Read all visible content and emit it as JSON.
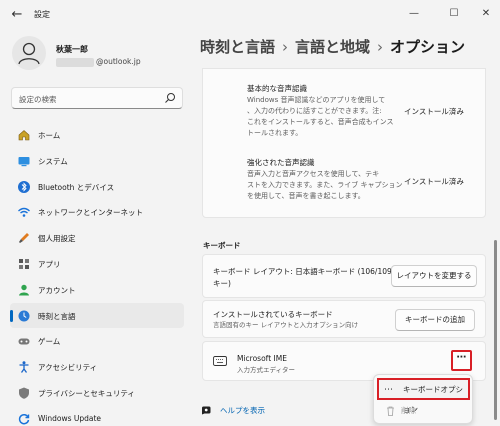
{
  "window": {
    "title": "設定",
    "back_glyph": "←",
    "minimize_glyph": "—",
    "maximize_glyph": "☐",
    "close_glyph": "✕"
  },
  "profile": {
    "name": "秋葉一郎",
    "email_suffix": "@outlook.jp"
  },
  "search": {
    "placeholder": "設定の検索"
  },
  "nav": {
    "items": [
      {
        "label": "ホーム",
        "icon": "home-icon"
      },
      {
        "label": "システム",
        "icon": "system-icon"
      },
      {
        "label": "Bluetooth とデバイス",
        "icon": "bluetooth-icon"
      },
      {
        "label": "ネットワークとインターネット",
        "icon": "network-icon"
      },
      {
        "label": "個人用設定",
        "icon": "personalization-icon"
      },
      {
        "label": "アプリ",
        "icon": "apps-icon"
      },
      {
        "label": "アカウント",
        "icon": "accounts-icon"
      },
      {
        "label": "時刻と言語",
        "icon": "time-language-icon",
        "active": true
      },
      {
        "label": "ゲーム",
        "icon": "gaming-icon"
      },
      {
        "label": "アクセシビリティ",
        "icon": "accessibility-icon"
      },
      {
        "label": "プライバシーとセキュリティ",
        "icon": "privacy-icon"
      },
      {
        "label": "Windows Update",
        "icon": "windows-update-icon"
      }
    ]
  },
  "breadcrumb": {
    "level1": "時刻と言語",
    "level2": "言語と地域",
    "current": "オプション",
    "separator": "›"
  },
  "speech": {
    "basic_title": "基本的な音声認識",
    "basic_desc_1": "Windows 音声認識などのアプリを使用して",
    "basic_desc_2": "、入力の代わりに話すことができます。注:",
    "basic_desc_3": "これをインストールすると、音声合成もインス",
    "basic_desc_4": "トールされます。",
    "basic_status": "インストール済み",
    "enhanced_title": "強化された音声認識",
    "enhanced_desc_1": "音声入力と音声アクセスを使用して、テキ",
    "enhanced_desc_2": "ストを入力できます。また、ライブ キャプション",
    "enhanced_desc_3": "を使用して、音声を書き起こします。",
    "enhanced_status": "インストール済み"
  },
  "keyboard_section": {
    "header": "キーボード",
    "layout_label_1": "キーボード レイアウト: 日本語キーボード (106/109",
    "layout_label_2": "キー)",
    "layout_button": "レイアウトを変更する",
    "installed_title": "インストールされているキーボード",
    "installed_desc": "言語固有のキー レイアウトと入力オプション向け",
    "add_keyboard_button": "キーボードの追加",
    "ime_title": "Microsoft IME",
    "ime_desc": "入力方式エディター",
    "more_glyph": "⋯"
  },
  "context_menu": {
    "options_label": "キーボードオプション",
    "options_glyph": "⋯",
    "remove_label": "削除"
  },
  "help": {
    "label": "ヘルプを表示"
  },
  "colors": {
    "accent": "#0067c0",
    "highlight_red": "#d81f26"
  }
}
